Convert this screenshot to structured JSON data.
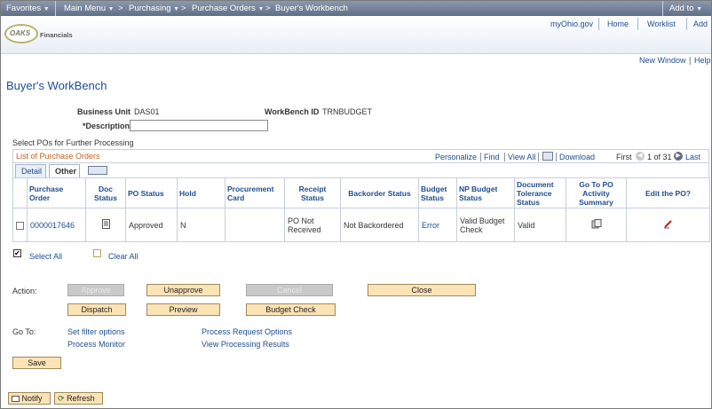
{
  "nav": {
    "favorites": "Favorites",
    "main_menu": "Main Menu",
    "purchasing": "Purchasing",
    "purchase_orders": "Purchase Orders",
    "current": "Buyer's Workbench",
    "add_to": "Add to"
  },
  "brand": {
    "oaks": "OAKS",
    "financials": "Financials"
  },
  "header_links": {
    "myohio": "myOhio.gov",
    "home": "Home",
    "worklist": "Worklist"
  },
  "page_links": {
    "new_window": "New Window",
    "help": "Help"
  },
  "page": {
    "title": "Buyer's WorkBench",
    "business_unit_label": "Business Unit",
    "business_unit_value": "DAS01",
    "workbench_id_label": "WorkBench ID",
    "workbench_id_value": "TRNBUDGET",
    "description_label": "*Description",
    "description_value": "",
    "select_instructions": "Select POs for Further Processing"
  },
  "grid": {
    "caption": "List of Purchase Orders",
    "personalize": "Personalize",
    "find": "Find",
    "view_all": "View All",
    "download": "Download",
    "first": "First",
    "range": "1 of 31",
    "last": "Last",
    "tabs": {
      "detail": "Detail",
      "other": "Other"
    },
    "columns": [
      "Purchase Order",
      "Doc Status",
      "PO Status",
      "Hold",
      "Procurement Card",
      "Receipt Status",
      "Backorder Status",
      "Budget Status",
      "NP Budget Status",
      "Document Tolerance Status",
      "Go To PO Activity Summary",
      "Edit the PO?"
    ],
    "rows": [
      {
        "po": "0000017646",
        "po_status": "Approved",
        "hold": "N",
        "procurement_card": "",
        "receipt_status": "PO Not Received",
        "backorder_status": "Not Backordered",
        "budget_status": "Error",
        "np_budget_status": "Valid Budget Check",
        "doc_tolerance": "Valid"
      }
    ]
  },
  "select_all": "Select All",
  "clear_all": "Clear All",
  "actions": {
    "label": "Action:",
    "approve": "Approve",
    "unapprove": "Unapprove",
    "cancel": "Cancel",
    "close": "Close",
    "dispatch": "Dispatch",
    "preview": "Preview",
    "budget_check": "Budget Check"
  },
  "goto": {
    "label": "Go To:",
    "set_filter": "Set filter options",
    "process_monitor": "Process Monitor",
    "process_request": "Process Request Options",
    "view_results": "View Processing Results"
  },
  "save": "Save",
  "notify": "Notify",
  "refresh": "Refresh"
}
